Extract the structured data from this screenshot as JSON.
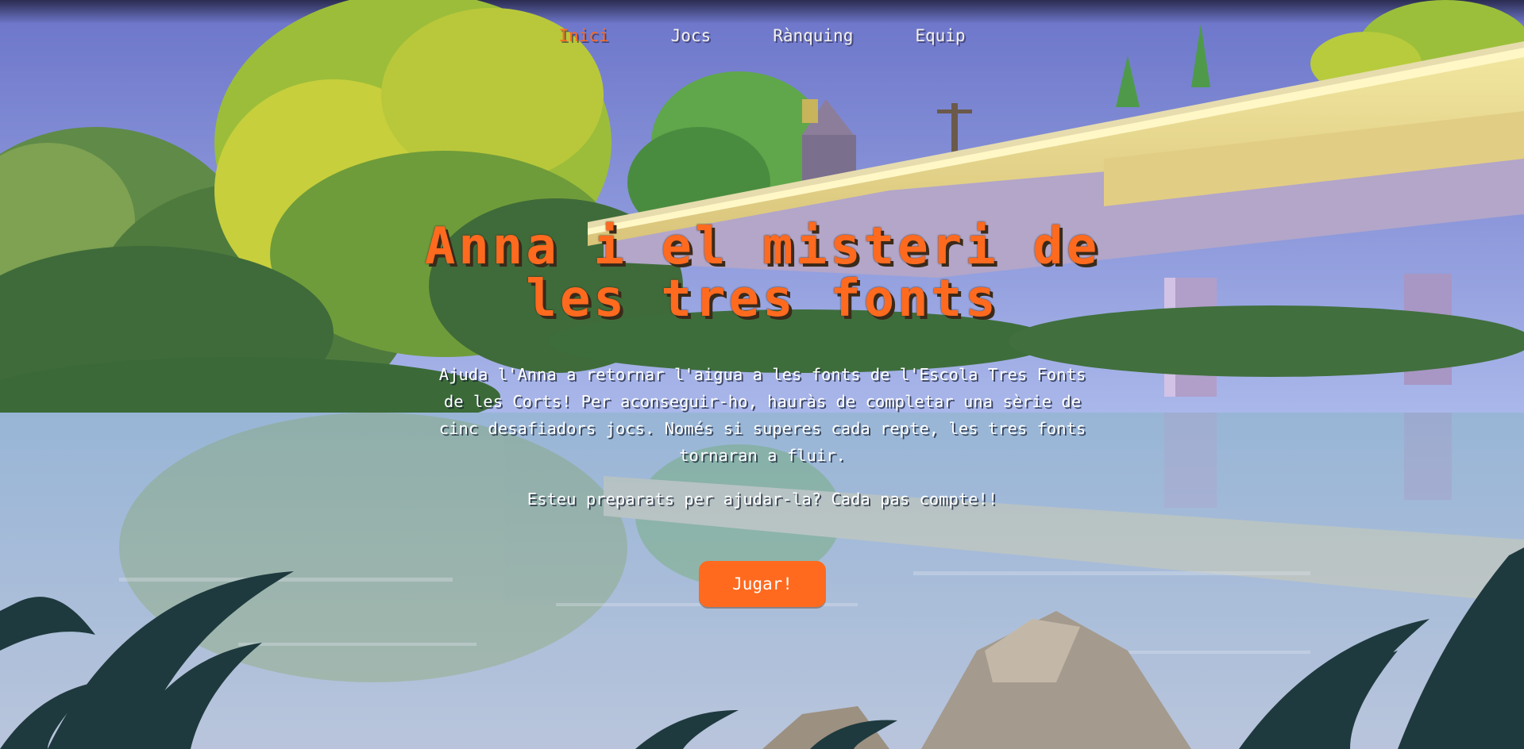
{
  "nav": {
    "items": [
      {
        "label": "Inici",
        "active": true
      },
      {
        "label": "Jocs",
        "active": false
      },
      {
        "label": "Rànquing",
        "active": false
      },
      {
        "label": "Equip",
        "active": false
      }
    ]
  },
  "hero": {
    "title": "Anna i el misteri de les tres fonts",
    "description": "Ajuda l'Anna a retornar l'aigua a les fonts de l'Escola Tres Fonts de les Corts! Per aconseguir-ho, hauràs de completar una sèrie de cinc desafiadors jocs. Només si superes cada repte, les tres fonts tornaran a fluir.",
    "question": "Esteu preparats per ajudar-la? Cada pas compte!!",
    "play_label": "Jugar!"
  },
  "colors": {
    "accent": "#ff6a1f",
    "text": "#ffffff",
    "sky": "#8ea3d8",
    "water": "#9ab3cf"
  }
}
